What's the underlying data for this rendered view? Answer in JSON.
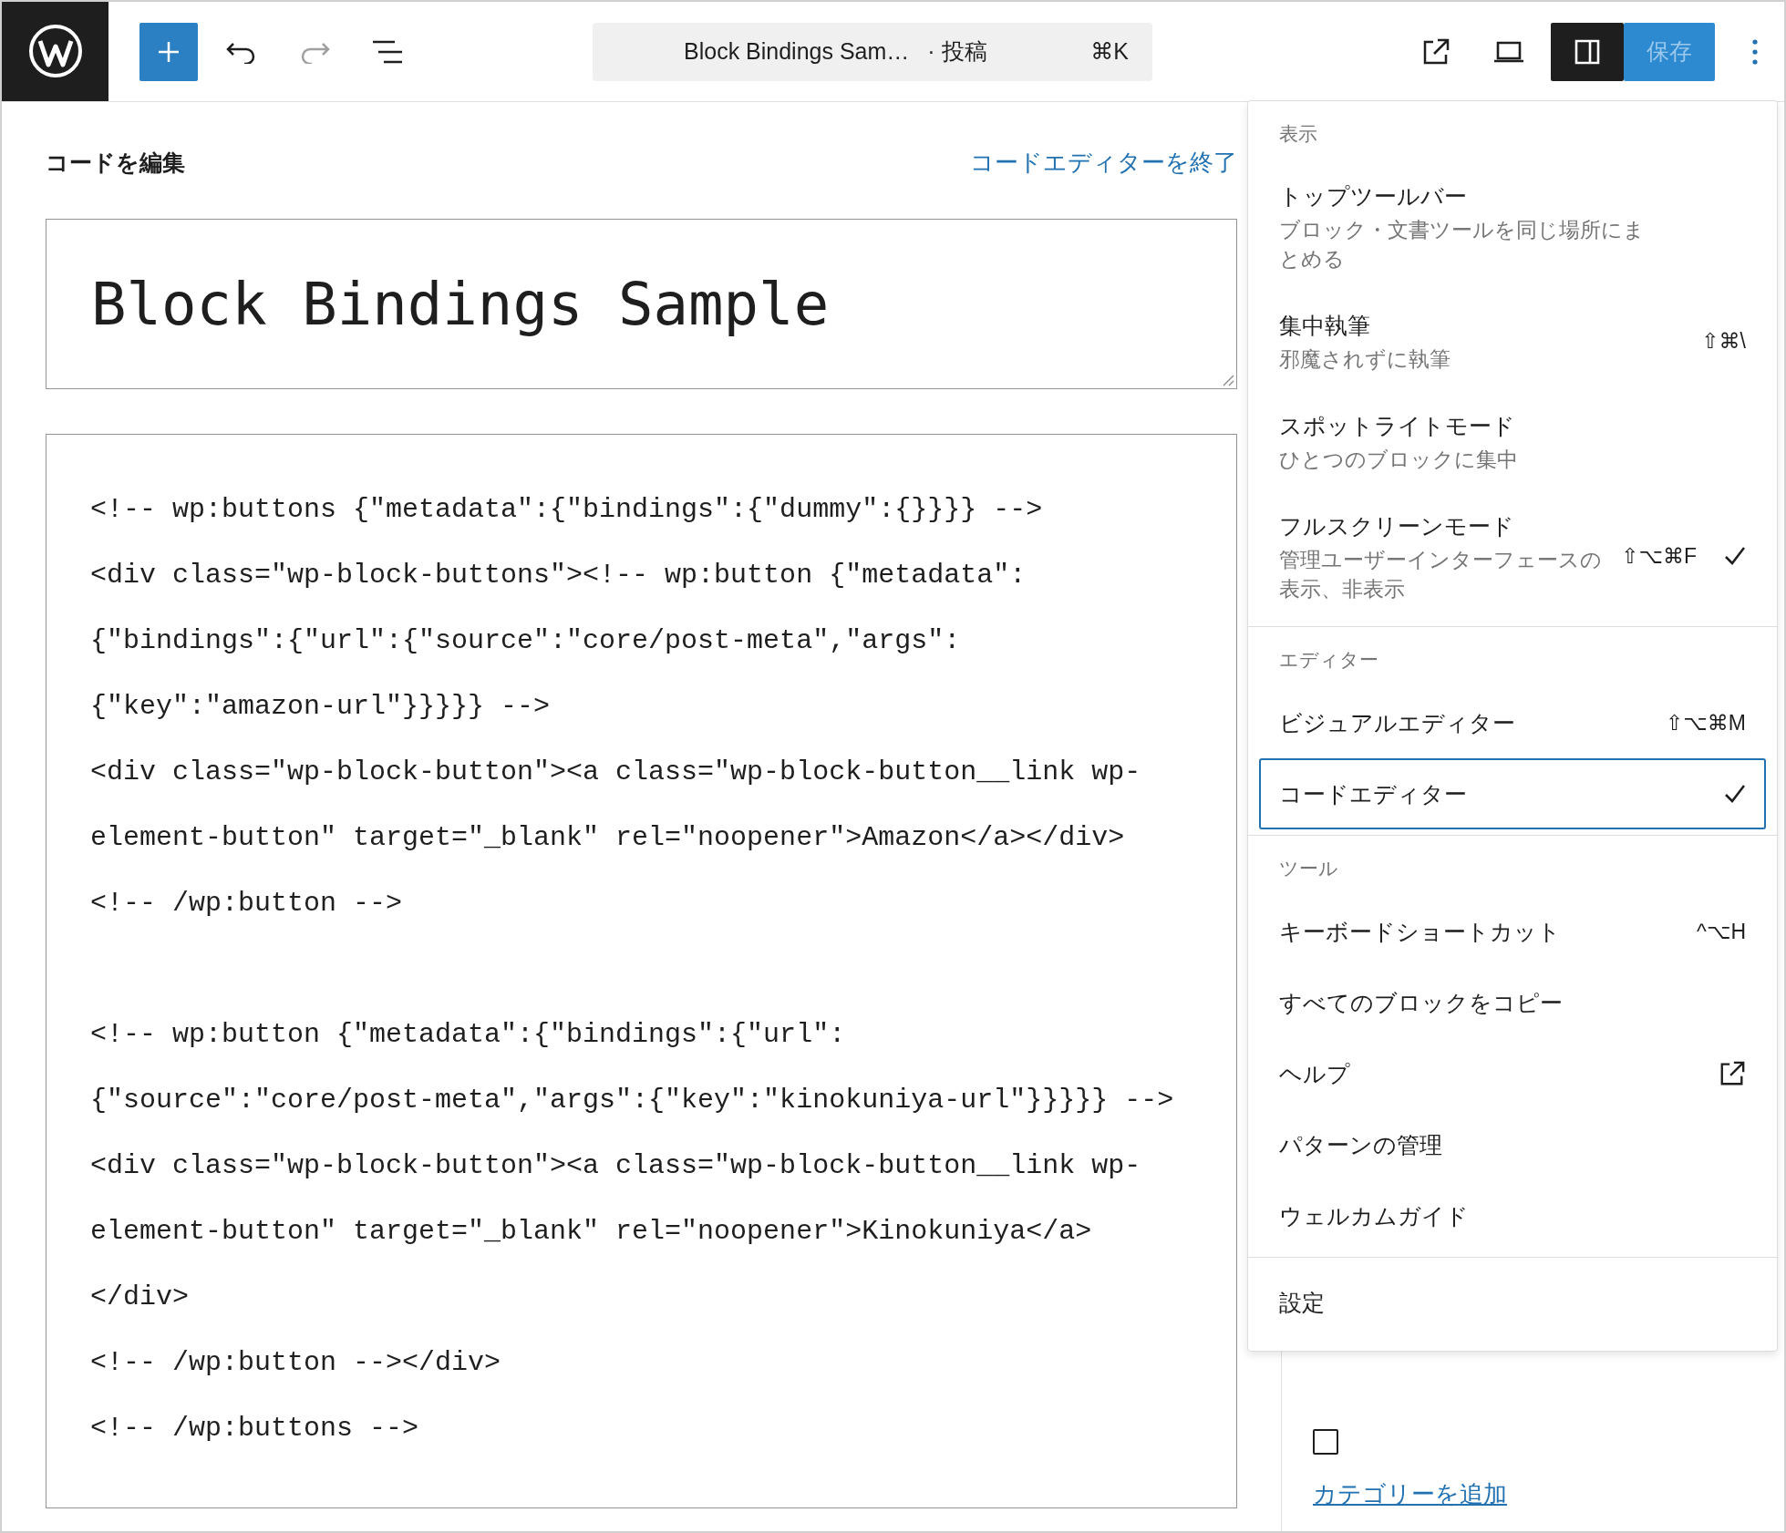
{
  "header": {
    "add_button": {
      "pressed": false
    },
    "undo": {
      "disabled": false
    },
    "redo": {
      "disabled": true
    },
    "command_bar": {
      "title": "Block Bindings Sam…",
      "post_type": "· 投稿",
      "shortcut": "⌘K"
    },
    "settings_toggle": {
      "pressed": true
    },
    "save_button": {
      "label": "保存",
      "disabled": true
    }
  },
  "editor": {
    "heading": "コードを編集",
    "exit_link": "コードエディターを終了",
    "post_title": "Block Bindings Sample",
    "code_blocks": [
      [
        "<!-- wp:buttons {\"metadata\":{\"bindings\":{\"dummy\":{}}}} -->",
        "<div class=\"wp-block-buttons\"><!-- wp:button {\"metadata\":",
        "{\"bindings\":{\"url\":{\"source\":\"core/post-meta\",\"args\":",
        "{\"key\":\"amazon-url\"}}}}} -->",
        "<div class=\"wp-block-button\"><a class=\"wp-block-button__link wp-",
        "element-button\" target=\"_blank\" rel=\"noopener\">Amazon</a></div>",
        "<!-- /wp:button -->"
      ],
      [
        "<!-- wp:button {\"metadata\":{\"bindings\":{\"url\":",
        "{\"source\":\"core/post-meta\",\"args\":{\"key\":\"kinokuniya-url\"}}}}} -->",
        "<div class=\"wp-block-button\"><a class=\"wp-block-button__link wp-",
        "element-button\" target=\"_blank\" rel=\"noopener\">Kinokuniya</a>",
        "</div>",
        "<!-- /wp:button --></div>",
        "<!-- /wp:buttons -->"
      ]
    ]
  },
  "sidebar": {
    "category_checkbox": {
      "checked": false
    },
    "add_category_link": "カテゴリーを追加"
  },
  "options_menu": {
    "sections": [
      {
        "header": "表示",
        "items": [
          {
            "kind": "toggle",
            "label": "トップツールバー",
            "description": "ブロック・文書ツールを同じ場所にまとめる",
            "checked": false,
            "selected": false
          },
          {
            "kind": "toggle",
            "label": "集中執筆",
            "description": "邪魔されずに執筆",
            "shortcut": "⇧⌘\\",
            "checked": false,
            "selected": false
          },
          {
            "kind": "toggle",
            "label": "スポットライトモード",
            "description": "ひとつのブロックに集中",
            "checked": false,
            "selected": false
          },
          {
            "kind": "toggle",
            "label": "フルスクリーンモード",
            "description": "管理ユーザーインターフェースの表示、非表示",
            "shortcut": "⇧⌥⌘F",
            "checked": true,
            "selected": false
          }
        ]
      },
      {
        "header": "エディター",
        "items": [
          {
            "kind": "toggle",
            "label": "ビジュアルエディター",
            "shortcut": "⇧⌥⌘M",
            "checked": false,
            "selected": false
          },
          {
            "kind": "toggle",
            "label": "コードエディター",
            "checked": true,
            "selected": true
          }
        ]
      },
      {
        "header": "ツール",
        "items": [
          {
            "kind": "action",
            "label": "キーボードショートカット",
            "shortcut": "^⌥H",
            "checked": false,
            "selected": false
          },
          {
            "kind": "action",
            "label": "すべてのブロックをコピー",
            "checked": false,
            "selected": false
          },
          {
            "kind": "external",
            "label": "ヘルプ",
            "checked": false,
            "selected": false
          },
          {
            "kind": "action",
            "label": "パターンの管理",
            "checked": false,
            "selected": false
          },
          {
            "kind": "action",
            "label": "ウェルカムガイド",
            "checked": false,
            "selected": false
          }
        ]
      },
      {
        "items": [
          {
            "kind": "action",
            "label": "設定",
            "checked": false,
            "selected": false
          }
        ]
      }
    ]
  }
}
